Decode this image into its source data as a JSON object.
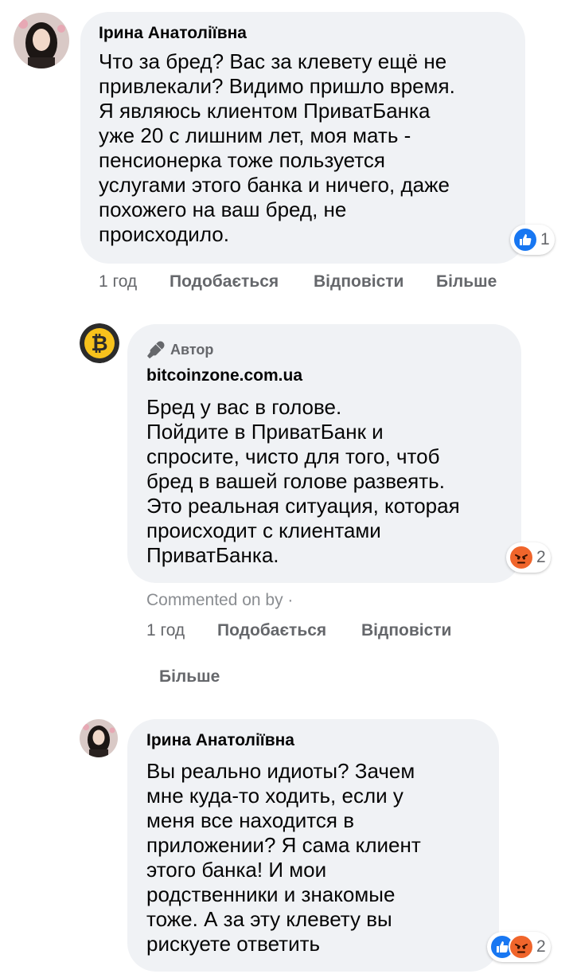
{
  "comments": [
    {
      "author": "Ірина Анатоліївна",
      "text": "Что за бред? Вас за клевету ещё не\nпривлекали? Видимо пришло время.\nЯ являюсь клиентом ПриватБанка\nуже 20 с лишним лет, моя мать -\nпенсионерка тоже пользуется\nуслугами этого банка и ничего, даже\nпохожего на ваш бред, не\nпроисходило.",
      "reactions": {
        "icons": [
          "like-icon"
        ],
        "count": "1"
      },
      "time": "1 год",
      "like_label": "Подобається",
      "reply_label": "Відповісти",
      "more_label": "Більше"
    },
    {
      "author_badge": "Автор",
      "author": "bitcoinzone.com.ua",
      "text": "Бред у вас в голове.\nПойдите в ПриватБанк и\nспросите, чисто для того, чтоб\nбред в вашей голове развеять.\nЭто реальная ситуация, которая\nпроисходит с клиентами\nПриватБанка.",
      "reactions": {
        "icons": [
          "angry-icon"
        ],
        "count": "2"
      },
      "commented_on": "Commented on by ·",
      "time": "1 год",
      "like_label": "Подобається",
      "reply_label": "Відповісти",
      "more_label": "Більше"
    },
    {
      "author": "Ірина Анатоліївна",
      "text": "Вы реально идиоты? Зачем\nмне куда-то ходить, если у\nменя все находится в\nприложении? Я сама клиент\nэтого банка! И мои\nродственники и знакомые\nтоже. А за эту клевету вы\nрискуете ответить",
      "reactions": {
        "icons": [
          "like-icon",
          "angry-icon"
        ],
        "count": "2"
      }
    }
  ],
  "colors": {
    "bubble": "#f0f2f5",
    "like_blue": "#1877f2",
    "angry_orange": "#f0652b",
    "bitcoin_gold": "#f7c21c",
    "secondary_text": "#65676b"
  }
}
